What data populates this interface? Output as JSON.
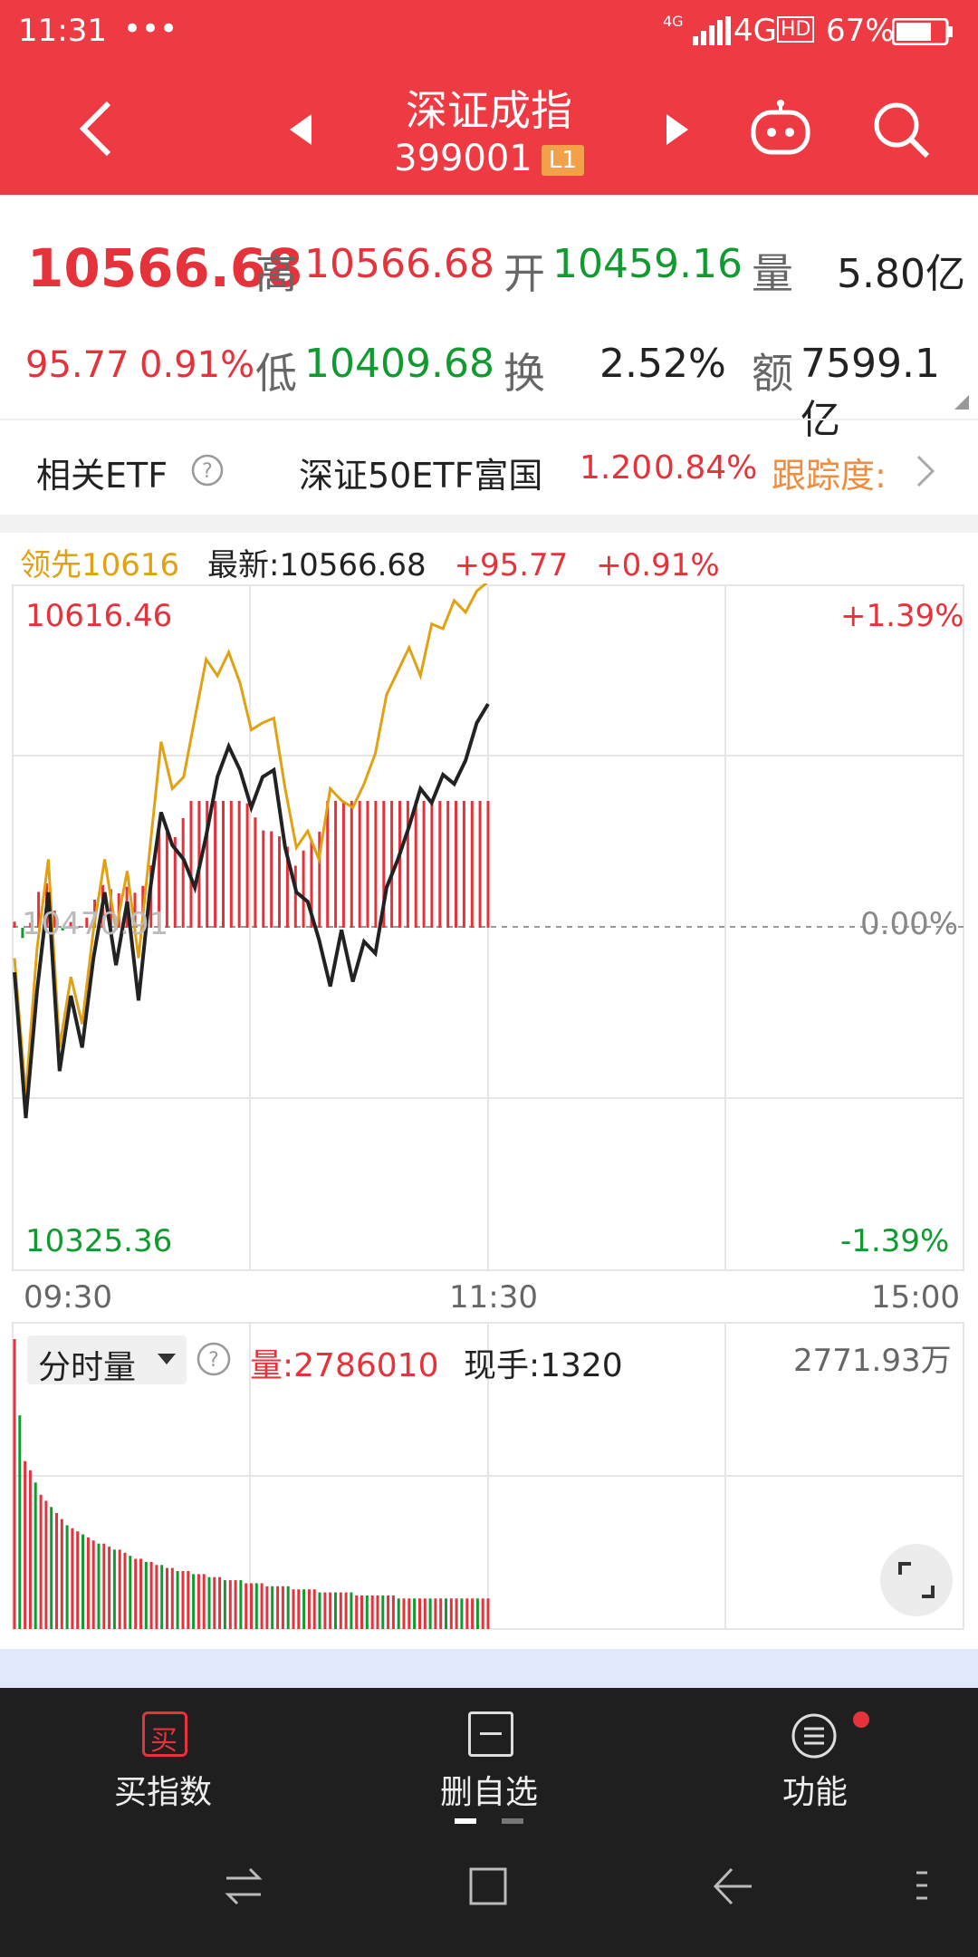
{
  "status": {
    "time": "11:31",
    "dots": "•••",
    "signal_small": "4G",
    "network": "4G",
    "hd": "HD",
    "battery": "67%"
  },
  "header": {
    "title": "深证成指",
    "code": "399001",
    "level": "L1"
  },
  "quote": {
    "price": "10566.68",
    "change": "95.77",
    "change_pct": "0.91%",
    "high_label": "高",
    "high": "10566.68",
    "low_label": "低",
    "low": "10409.68",
    "open_label": "开",
    "open": "10459.16",
    "turnover_label": "换",
    "turnover": "2.52%",
    "volume_label": "量",
    "volume": "5.80亿",
    "amount_label": "额",
    "amount": "7599.1亿"
  },
  "etf": {
    "label": "相关ETF",
    "name": "深证50ETF富国",
    "price": "1.20",
    "pct": "0.84%",
    "track": "跟踪度:"
  },
  "chart_info": {
    "lead_label": "领先",
    "lead_value": "10616",
    "latest_label": "最新:",
    "latest": "10566.68",
    "change": "+95.77",
    "pct": "+0.91%"
  },
  "axis": {
    "y_top": "10616.46",
    "y_bottom": "10325.36",
    "y_mid": "10470.91",
    "pct_top": "+1.39%",
    "pct_mid": "0.00%",
    "pct_bottom": "-1.39%",
    "t_start": "09:30",
    "t_mid": "11:30",
    "t_end": "15:00"
  },
  "volume_panel": {
    "selector": "分时量",
    "vol_label": "量:",
    "vol": "2786010",
    "hand_label": "现手:",
    "hand": "1320",
    "right_value": "2771.93万"
  },
  "bottom": {
    "buy": "买指数",
    "buy_icon": "买",
    "remove": "删自选",
    "func": "功能"
  },
  "colors": {
    "brand_red": "#ee3b43",
    "price_line": "#222222",
    "lead_line": "#e0a112",
    "up": "#e5323b",
    "down": "#119a30"
  },
  "chart_data": [
    {
      "type": "line",
      "x_range": [
        "09:30",
        "15:00"
      ],
      "ylim": [
        10325.36,
        10616.46
      ],
      "prev_close": 10470.91,
      "series": [
        {
          "name": "最新",
          "values": [
            10452,
            10390,
            10444,
            10486,
            10410,
            10442,
            10420,
            10458,
            10486,
            10455,
            10482,
            10440,
            10486,
            10520,
            10506,
            10500,
            10488,
            10510,
            10535,
            10548,
            10538,
            10522,
            10535,
            10538,
            10505,
            10486,
            10482,
            10466,
            10446,
            10470,
            10448,
            10465,
            10460,
            10488,
            10500,
            10514,
            10530,
            10524,
            10536,
            10532,
            10542,
            10558,
            10566
          ]
        },
        {
          "name": "领先",
          "values": [
            10458,
            10400,
            10462,
            10500,
            10420,
            10450,
            10430,
            10470,
            10500,
            10470,
            10495,
            10458,
            10504,
            10550,
            10530,
            10535,
            10560,
            10585,
            10578,
            10588,
            10575,
            10555,
            10558,
            10560,
            10530,
            10505,
            10512,
            10500,
            10530,
            10525,
            10522,
            10532,
            10545,
            10570,
            10580,
            10590,
            10578,
            10600,
            10598,
            10610,
            10605,
            10614,
            10618
          ]
        }
      ]
    },
    {
      "type": "bar",
      "title": "分时量",
      "values": [
        95,
        70,
        55,
        52,
        48,
        44,
        42,
        40,
        38,
        36,
        34,
        33,
        32,
        31,
        30,
        29,
        28,
        28,
        27,
        26,
        26,
        25,
        24,
        23,
        23,
        22,
        22,
        21,
        21,
        20,
        20,
        19,
        19,
        19,
        18,
        18,
        18,
        17,
        17,
        17,
        16,
        16,
        16,
        16,
        15,
        15,
        15,
        15,
        14,
        14,
        14,
        14,
        14,
        13,
        13,
        13,
        13,
        13,
        12,
        12,
        12,
        12,
        12,
        12,
        12,
        11,
        11,
        11,
        11,
        11,
        11,
        11,
        11,
        10,
        10,
        10,
        10,
        10,
        10,
        10,
        10,
        10,
        10,
        10,
        10,
        10,
        10,
        10,
        10,
        10,
        10
      ]
    }
  ]
}
